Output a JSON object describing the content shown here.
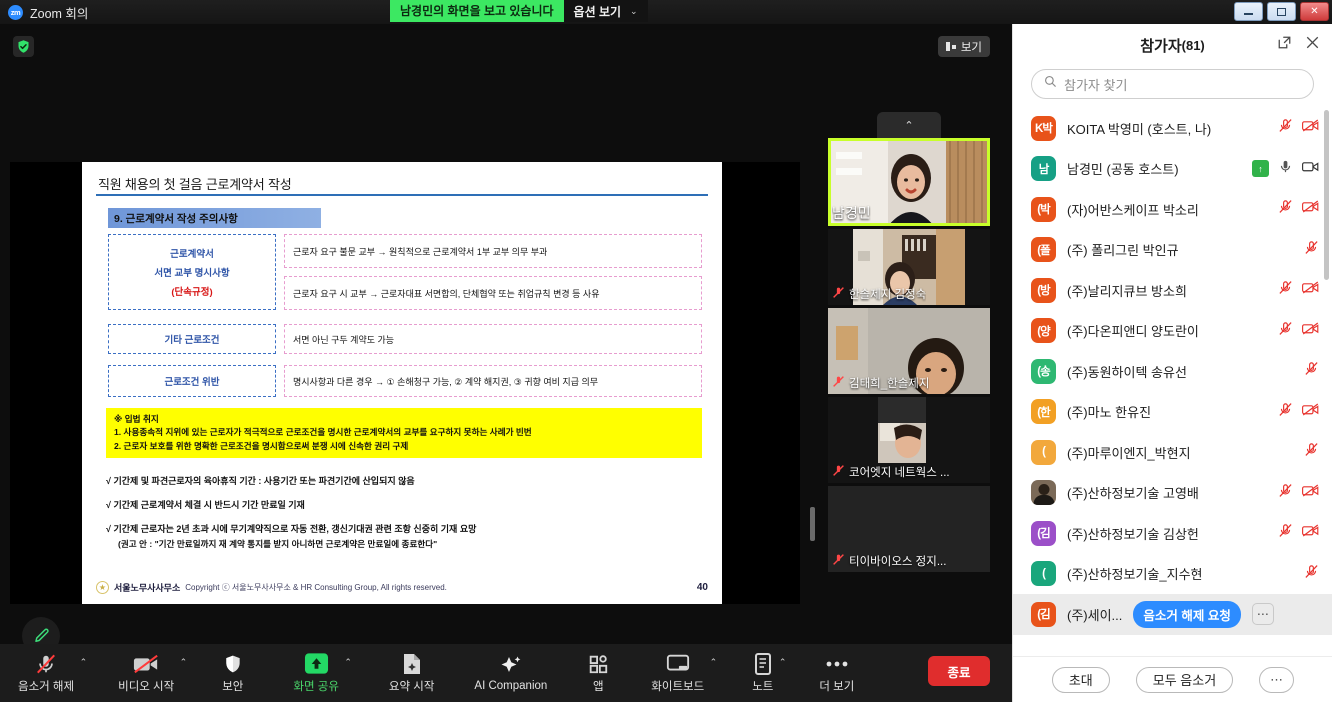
{
  "titlebar": {
    "app_title": "Zoom 회의",
    "logo_text": "zm",
    "share_notice": "남경민의 화면을 보고 있습니다",
    "view_options": "옵션 보기",
    "chevron": "⌄"
  },
  "stage": {
    "view_button": "보기",
    "collapse_chevron": "⌃",
    "share_border_color": "#6a6a6a"
  },
  "slide": {
    "title": "직원 채용의 첫 걸음 근로계약서 작성",
    "section": "9. 근로계약서 작성 주의사항",
    "rows": [
      {
        "left_lines": [
          "근로계약서",
          "서면 교부 명시사항",
          "(단속규정)"
        ],
        "right": "근로자 요구 불문 교부 → 원칙적으로 근로계약서 1부 교부 의무 부과"
      },
      {
        "left_lines": [],
        "right": "근로자 요구 시 교부 → 근로자대표 서면합의, 단체협약 또는 취업규칙 변경 등 사유"
      },
      {
        "left_lines": [
          "기타 근로조건"
        ],
        "right": "서면 아닌 구두 계약도 가능"
      },
      {
        "left_lines": [
          "근로조건 위반"
        ],
        "right": "명시사항과 다른 경우 → ① 손해청구 가능, ② 계약 해지권, ③ 귀향 여비 지급 의무"
      }
    ],
    "highlight_heading": "※ 입법 취지",
    "highlight_items": [
      "1.  사용종속적 지위에 있는 근로자가 적극적으로 근로조건을 명시한 근로계약서의 교부를 요구하지 못하는 사례가 빈번",
      "2.  근로자 보호를 위한 명확한 근로조건을 명시함으로써 분쟁 시에 신속한 권리 구제"
    ],
    "checks": [
      {
        "text": "√ 기간제 및 파견근로자의 육아휴직 기간 : 사용기간 또는 파견기간에 산입되지 않음",
        "sub": ""
      },
      {
        "text": "√ 기간제 근로계약서 체결 시 반드시 기간 만료일 기재",
        "sub": ""
      },
      {
        "text": "√ 기간제 근로자는 2년 초과 시에 무기계약직으로 자동 전환, 갱신기대권 관련 조항 신중히 기재 요망",
        "sub": "(권고 안 : \"기간 만료일까지 재 계약 통지를 받지 아니하면 근로계약은 만료일에 종료한다\""
      }
    ],
    "footer_brand": "서울노무사사무소",
    "footer_copy": "Copyright ⓒ 서울노무사사무소 & HR Consulting Group, All rights reserved.",
    "page_number": "40"
  },
  "filmstrip": [
    {
      "name": "남경민",
      "muted": false,
      "active": true,
      "has_video": true
    },
    {
      "name": "한솔제지 김정숙",
      "muted": true,
      "active": false,
      "has_video": true
    },
    {
      "name": "김태희_한솔제지",
      "muted": true,
      "active": false,
      "has_video": true
    },
    {
      "name": "코어엣지 네트웍스 ...",
      "muted": true,
      "active": false,
      "has_video": true
    },
    {
      "name": "티이바이오스 정지...",
      "muted": true,
      "active": false,
      "has_video": false
    }
  ],
  "toolbar": {
    "items": [
      {
        "label": "음소거 해제",
        "icon": "mic-off-icon",
        "caret": true,
        "green": false
      },
      {
        "label": "비디오 시작",
        "icon": "video-off-icon",
        "caret": true,
        "green": false
      },
      {
        "label": "보안",
        "icon": "shield-icon",
        "caret": false,
        "green": false
      },
      {
        "label": "화면 공유",
        "icon": "share-screen-icon",
        "caret": true,
        "green": true
      },
      {
        "label": "요약 시작",
        "icon": "summary-icon",
        "caret": false,
        "green": false
      },
      {
        "label": "AI Companion",
        "icon": "sparkle-icon",
        "caret": false,
        "green": false
      },
      {
        "label": "앱",
        "icon": "apps-icon",
        "caret": false,
        "green": false
      },
      {
        "label": "화이트보드",
        "icon": "whiteboard-icon",
        "caret": true,
        "green": false
      },
      {
        "label": "노트",
        "icon": "notes-icon",
        "caret": true,
        "green": false
      },
      {
        "label": "더 보기",
        "icon": "more-icon",
        "caret": false,
        "green": false
      }
    ],
    "end_label": "종료",
    "end_color": "#e02d2d"
  },
  "panel": {
    "title": "참가자",
    "count": "(81)",
    "search_placeholder": "참가자 찾기",
    "footer": {
      "invite": "초대",
      "mute_all": "모두 음소거",
      "more": "⋯"
    },
    "unmute_request_label": "음소거 해제 요청",
    "row_more_label": "⋯",
    "participants": [
      {
        "initial": "K박",
        "color": "#e8531a",
        "name": "KOITA 박영미 (호스트, 나)",
        "mic": "muted",
        "cam": "off",
        "raised": false,
        "selected": false
      },
      {
        "initial": "남",
        "color": "#16a085",
        "name": "남경민 (공동 호스트)",
        "mic": "on",
        "cam": "on",
        "raised": true,
        "selected": false
      },
      {
        "initial": "(박",
        "color": "#e8531a",
        "name": "(자)어반스케이프 박소리",
        "mic": "muted",
        "cam": "off",
        "raised": false,
        "selected": false
      },
      {
        "initial": "(폴",
        "color": "#e8531a",
        "name": "(주) 폴리그린 박인규",
        "mic": "muted",
        "cam": "none",
        "raised": false,
        "selected": false
      },
      {
        "initial": "(방",
        "color": "#e8531a",
        "name": "(주)날리지큐브 방소희",
        "mic": "muted",
        "cam": "off",
        "raised": false,
        "selected": false
      },
      {
        "initial": "(양",
        "color": "#e8531a",
        "name": "(주)다온피앤디 양도란이",
        "mic": "muted",
        "cam": "off",
        "raised": false,
        "selected": false
      },
      {
        "initial": "(송",
        "color": "#2eb872",
        "name": "(주)동원하이텍 송유선",
        "mic": "muted",
        "cam": "none",
        "raised": false,
        "selected": false
      },
      {
        "initial": "(한",
        "color": "#f2a024",
        "name": "(주)마노 한유진",
        "mic": "muted",
        "cam": "off",
        "raised": false,
        "selected": false
      },
      {
        "initial": "(",
        "color": "#f2a83c",
        "name": "(주)마루이엔지_박현지",
        "mic": "muted",
        "cam": "none",
        "raised": false,
        "selected": false
      },
      {
        "initial": "photo",
        "color": "#7b6a58",
        "name": "(주)산하정보기술 고영배",
        "mic": "muted",
        "cam": "off",
        "raised": false,
        "selected": false
      },
      {
        "initial": "(김",
        "color": "#9b4fc8",
        "name": "(주)산하정보기술 김상헌",
        "mic": "muted",
        "cam": "off",
        "raised": false,
        "selected": false
      },
      {
        "initial": "(",
        "color": "#1aa67c",
        "name": "(주)산하정보기술_지수현",
        "mic": "muted",
        "cam": "none",
        "raised": false,
        "selected": false
      },
      {
        "initial": "(김",
        "color": "#e8531a",
        "name": "(주)세이...",
        "mic": "none",
        "cam": "none",
        "raised": false,
        "selected": true
      }
    ]
  }
}
